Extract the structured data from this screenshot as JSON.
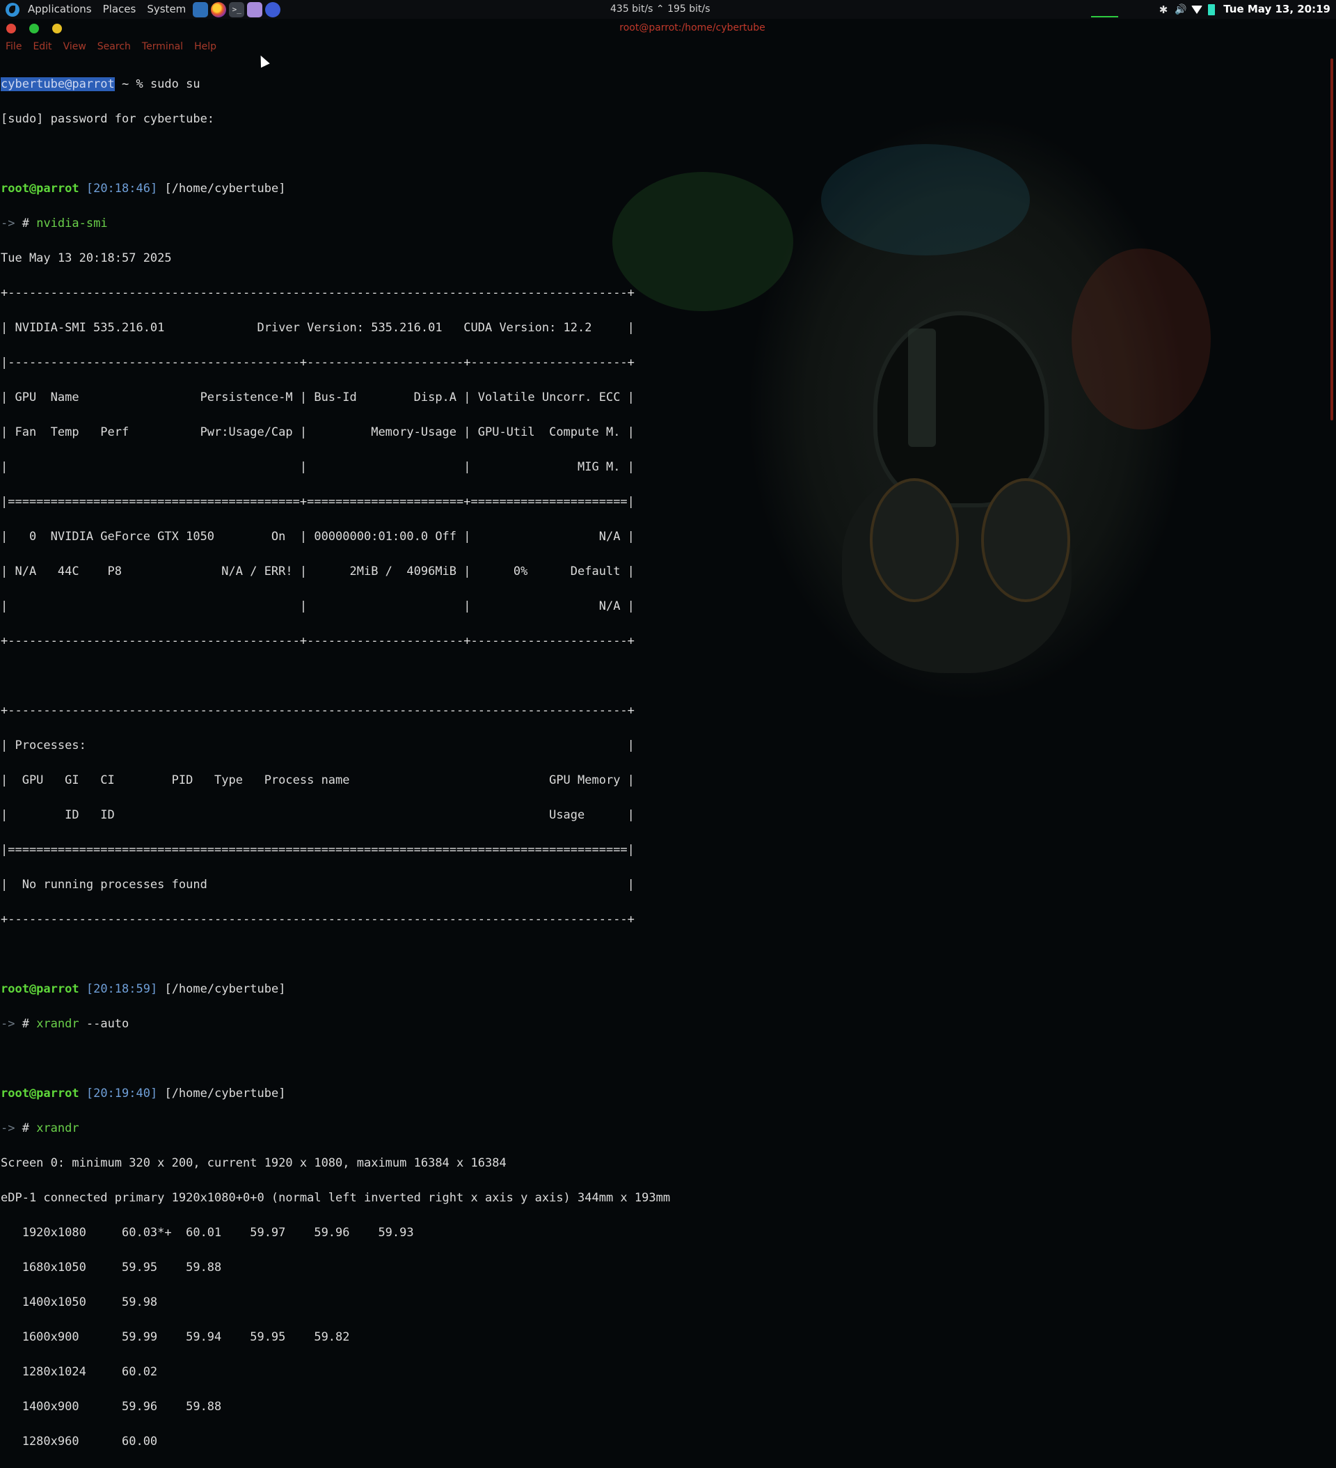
{
  "panel": {
    "menus": [
      "Applications",
      "Places",
      "System"
    ],
    "launchers": [
      "mail-icon",
      "firefox-icon",
      "terminal-icon",
      "text-editor-icon",
      "vscode-icon"
    ],
    "netmon": "435 bit/s ⌃ 195 bit/s",
    "tray": [
      "bluetooth-icon",
      "volume-icon",
      "wifi-icon",
      "battery-icon"
    ],
    "clock": "Tue May 13, 20:19"
  },
  "window": {
    "title": "root@parrot:/home/cybertube",
    "menu": [
      "File",
      "Edit",
      "View",
      "Search",
      "Terminal",
      "Help"
    ]
  },
  "terminal": {
    "prompt_user_highlight": "cybertube@parrot",
    "prompt_rest": " ~ % sudo su",
    "lines": [
      "[sudo] password for cybertube:",
      "",
      "",
      "",
      "Tue May 13 20:18:57 2025",
      "+---------------------------------------------------------------------------------------+",
      "| NVIDIA-SMI 535.216.01             Driver Version: 535.216.01   CUDA Version: 12.2     |",
      "|-----------------------------------------+----------------------+----------------------+",
      "| GPU  Name                 Persistence-M | Bus-Id        Disp.A | Volatile Uncorr. ECC |",
      "| Fan  Temp   Perf          Pwr:Usage/Cap |         Memory-Usage | GPU-Util  Compute M. |",
      "|                                         |                      |               MIG M. |",
      "|=========================================+======================+======================|",
      "|   0  NVIDIA GeForce GTX 1050        On  | 00000000:01:00.0 Off |                  N/A |",
      "| N/A   44C    P8              N/A / ERR! |      2MiB /  4096MiB |      0%      Default |",
      "|                                         |                      |                  N/A |",
      "+-----------------------------------------+----------------------+----------------------+",
      "",
      "+---------------------------------------------------------------------------------------+",
      "| Processes:                                                                            |",
      "|  GPU   GI   CI        PID   Type   Process name                            GPU Memory |",
      "|        ID   ID                                                             Usage      |",
      "|=======================================================================================|",
      "|  No running processes found                                                           |",
      "+---------------------------------------------------------------------------------------+",
      "",
      "",
      "",
      "",
      "",
      "",
      "Screen 0: minimum 320 x 200, current 1920 x 1080, maximum 16384 x 16384",
      "eDP-1 connected primary 1920x1080+0+0 (normal left inverted right x axis y axis) 344mm x 193mm",
      "   1920x1080     60.03*+  60.01    59.97    59.96    59.93",
      "   1680x1050     59.95    59.88",
      "   1400x1050     59.98",
      "   1600x900      59.99    59.94    59.95    59.82",
      "   1280x1024     60.02",
      "   1400x900      59.96    59.88",
      "   1280x960      60.00"
    ],
    "prompts": [
      {
        "user": "root@parrot",
        "time": "[20:18:46]",
        "path": "[/home/cybertube]",
        "arrow": "-> ",
        "hash": "#",
        "cmd": " nvidia-smi",
        "args": ""
      },
      {
        "user": "root@parrot",
        "time": "[20:18:59]",
        "path": "[/home/cybertube]",
        "arrow": "-> ",
        "hash": "#",
        "cmd": " xrandr",
        "args": " --auto"
      },
      {
        "user": "root@parrot",
        "time": "[20:19:40]",
        "path": "[/home/cybertube]",
        "arrow": "-> ",
        "hash": "#",
        "cmd": " xrandr",
        "args": ""
      }
    ]
  }
}
